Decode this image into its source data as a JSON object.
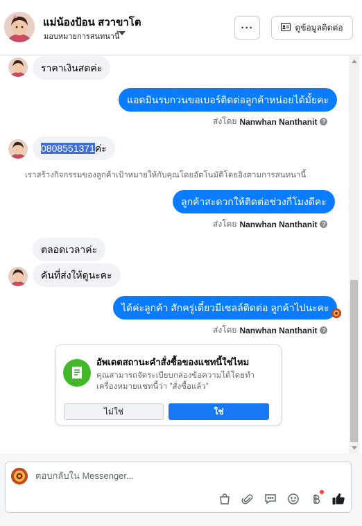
{
  "header": {
    "name": "แม่น้องป้อน สวาขาโต",
    "assign_label": "มอบหมายการสนทนานี้",
    "more_label": "···",
    "contact_info_label": "ดูข้อมูลติดต่อ"
  },
  "messages": {
    "m1": "ราคาเงินสดค่ะ",
    "m2": "แอดมินรบกวนขอเบอร์ติดต่อลูกค้าหน่อยได้มั้ยคะ",
    "m3_highlight": "0808551371",
    "m3_rest": "ค่ะ",
    "m4": "ลูกค้าสะดวกให้ติดต่อช่วงกี่โมงดีคะ",
    "m5": "ตลอดเวลาค่ะ",
    "m6": "คันที่ส่งให้ดูนะคะ",
    "m7": "ได้ค่ะลูกค้า สักครู่เดี๋ยวมีเซลล์ติดต่อ ลูกค้าไปนะคะ"
  },
  "sent_by": {
    "prefix": "ส่งโดย",
    "name": "Nanwhan Nanthanit"
  },
  "system_note": "เราสร้างกิจกรรมของลูกค้าเป้าหมายให้กับคุณโดยอัตโนมัติโดยอิงตามการสนทนานี้",
  "card": {
    "title": "อัพเดตสถานะคำสั่งซื้อของแชทนี้ใช่ไหม",
    "description": "คุณสามารถจัดระเบียบกล่องข้อความได้โดยทำเครื่องหมายแชทนี้ว่า \"สั่งซื้อแล้ว\"",
    "no_label": "ไม่ใช่",
    "yes_label": "ใช่"
  },
  "composer": {
    "placeholder": "ตอบกลับใน Messenger..."
  },
  "colors": {
    "outgoing_bubble": "#0a7cff",
    "incoming_bubble": "#f0f2f5",
    "primary_button": "#1877f2",
    "card_icon": "#42b72a"
  },
  "icons": [
    "bag-icon",
    "paperclip-icon",
    "saved-reply-icon",
    "emoji-icon",
    "baht-payment-icon",
    "thumbs-up-icon",
    "info-icon",
    "receipt-icon",
    "contact-card-icon"
  ]
}
